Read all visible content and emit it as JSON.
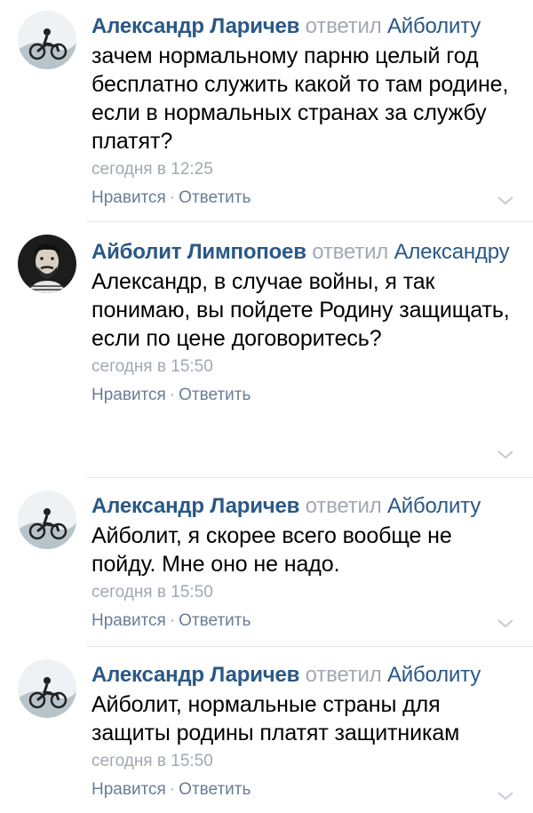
{
  "comments": [
    {
      "author": "Александр Ларичев",
      "replied": "ответил",
      "target": "Айболиту",
      "text": "зачем нормальному парню целый год бесплатно служить какой то там родине, если в нормальных странах за службу платят?",
      "time": "сегодня в 12:25",
      "like_label": "Нравится",
      "dot": "·",
      "reply_label": "Ответить",
      "avatar_icon": "motorbike-rider-avatar"
    },
    {
      "author": "Айболит Лимпопоев",
      "replied": "ответил",
      "target": "Александру",
      "text": "Александр, в случае войны, я так понимаю, вы пойдете Родину защищать, если по цене договоритесь?",
      "time": "сегодня в 15:50",
      "like_label": "Нравится",
      "dot": "·",
      "reply_label": "Ответить",
      "avatar_icon": "bearded-man-avatar"
    },
    {
      "author": "Александр Ларичев",
      "replied": "ответил",
      "target": "Айболиту",
      "text": "Айболит, я скорее всего вообще не пойду. Мне оно не надо.",
      "time": "сегодня в 15:50",
      "like_label": "Нравится",
      "dot": "·",
      "reply_label": "Ответить",
      "avatar_icon": "motorbike-rider-avatar"
    },
    {
      "author": "Александр Ларичев",
      "replied": "ответил",
      "target": "Айболиту",
      "text": "Айболит, нормальные страны для защиты родины платят защитникам",
      "time": "сегодня в 15:50",
      "like_label": "Нравится",
      "dot": "·",
      "reply_label": "Ответить",
      "avatar_icon": "motorbike-rider-avatar"
    }
  ],
  "colors": {
    "link": "#2a5885",
    "muted": "#a2a8b2",
    "action": "#6a7d96",
    "separator": "#e3e4e8"
  }
}
